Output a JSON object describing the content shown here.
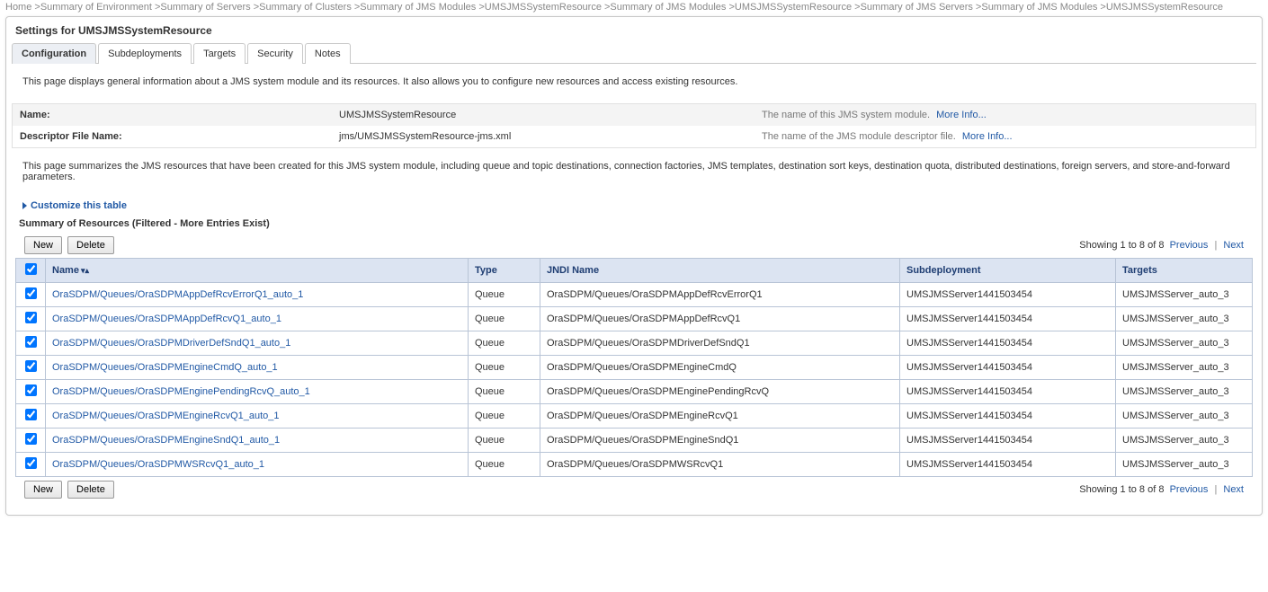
{
  "breadcrumb": "Home >Summary of Environment >Summary of Servers >Summary of Clusters >Summary of JMS Modules >UMSJMSSystemResource >Summary of JMS Modules >UMSJMSSystemResource >Summary of JMS Servers >Summary of JMS Modules >UMSJMSSystemResource",
  "panel_title": "Settings for UMSJMSSystemResource",
  "tabs": [
    "Configuration",
    "Subdeployments",
    "Targets",
    "Security",
    "Notes"
  ],
  "active_tab": 0,
  "desc1": "This page displays general information about a JMS system module and its resources. It also allows you to configure new resources and access existing resources.",
  "props": [
    {
      "label": "Name:",
      "value": "UMSJMSSystemResource",
      "help": "The name of this JMS system module.",
      "more": "More Info..."
    },
    {
      "label": "Descriptor File Name:",
      "value": "jms/UMSJMSSystemResource-jms.xml",
      "help": "The name of the JMS module descriptor file.",
      "more": "More Info..."
    }
  ],
  "desc2": "This page summarizes the JMS resources that have been created for this JMS system module, including queue and topic destinations, connection factories, JMS templates, destination sort keys, destination quota, distributed destinations, foreign servers, and store-and-forward parameters.",
  "customize_label": "Customize this table",
  "section_title": "Summary of Resources (Filtered - More Entries Exist)",
  "buttons": {
    "new": "New",
    "delete": "Delete"
  },
  "paging": {
    "text": "Showing 1 to 8 of 8",
    "prev": "Previous",
    "next": "Next"
  },
  "columns": {
    "name": "Name",
    "type": "Type",
    "jndi": "JNDI Name",
    "subd": "Subdeployment",
    "targets": "Targets"
  },
  "rows": [
    {
      "name": "OraSDPM/Queues/OraSDPMAppDefRcvErrorQ1_auto_1",
      "type": "Queue",
      "jndi": "OraSDPM/Queues/OraSDPMAppDefRcvErrorQ1",
      "subd": "UMSJMSServer1441503454",
      "targets": "UMSJMSServer_auto_3"
    },
    {
      "name": "OraSDPM/Queues/OraSDPMAppDefRcvQ1_auto_1",
      "type": "Queue",
      "jndi": "OraSDPM/Queues/OraSDPMAppDefRcvQ1",
      "subd": "UMSJMSServer1441503454",
      "targets": "UMSJMSServer_auto_3"
    },
    {
      "name": "OraSDPM/Queues/OraSDPMDriverDefSndQ1_auto_1",
      "type": "Queue",
      "jndi": "OraSDPM/Queues/OraSDPMDriverDefSndQ1",
      "subd": "UMSJMSServer1441503454",
      "targets": "UMSJMSServer_auto_3"
    },
    {
      "name": "OraSDPM/Queues/OraSDPMEngineCmdQ_auto_1",
      "type": "Queue",
      "jndi": "OraSDPM/Queues/OraSDPMEngineCmdQ",
      "subd": "UMSJMSServer1441503454",
      "targets": "UMSJMSServer_auto_3"
    },
    {
      "name": "OraSDPM/Queues/OraSDPMEnginePendingRcvQ_auto_1",
      "type": "Queue",
      "jndi": "OraSDPM/Queues/OraSDPMEnginePendingRcvQ",
      "subd": "UMSJMSServer1441503454",
      "targets": "UMSJMSServer_auto_3"
    },
    {
      "name": "OraSDPM/Queues/OraSDPMEngineRcvQ1_auto_1",
      "type": "Queue",
      "jndi": "OraSDPM/Queues/OraSDPMEngineRcvQ1",
      "subd": "UMSJMSServer1441503454",
      "targets": "UMSJMSServer_auto_3"
    },
    {
      "name": "OraSDPM/Queues/OraSDPMEngineSndQ1_auto_1",
      "type": "Queue",
      "jndi": "OraSDPM/Queues/OraSDPMEngineSndQ1",
      "subd": "UMSJMSServer1441503454",
      "targets": "UMSJMSServer_auto_3"
    },
    {
      "name": "OraSDPM/Queues/OraSDPMWSRcvQ1_auto_1",
      "type": "Queue",
      "jndi": "OraSDPM/Queues/OraSDPMWSRcvQ1",
      "subd": "UMSJMSServer1441503454",
      "targets": "UMSJMSServer_auto_3"
    }
  ]
}
